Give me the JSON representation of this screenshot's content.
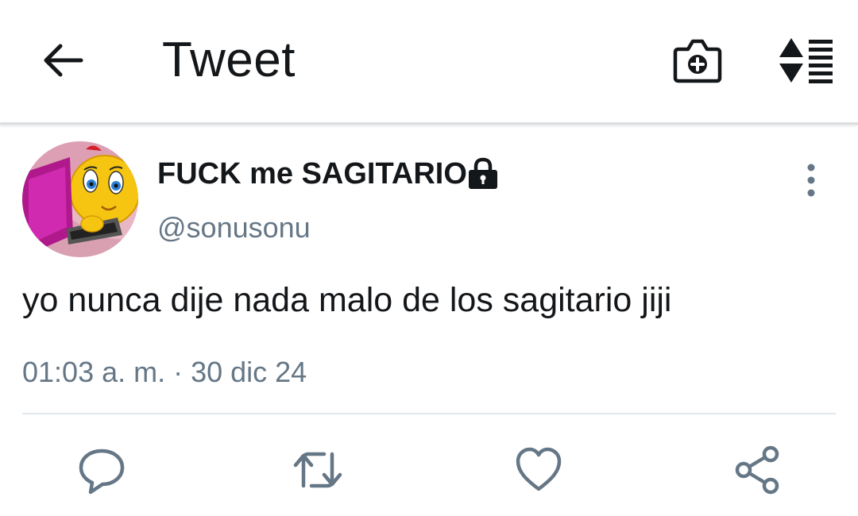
{
  "header": {
    "title": "Tweet",
    "back_icon": "arrow-left-icon",
    "camera_icon": "camera-add-icon",
    "sort_icon": "sort-list-icon"
  },
  "tweet": {
    "author_name": "FUCK me SAGITARIO",
    "handle": "@sonusonu",
    "protected_icon": "lock-icon",
    "text": "yo nunca dije nada malo de los sagitario jiji",
    "timestamp": "01:03 a. m. · 30 dic 24",
    "more_icon": "more-vertical-icon"
  },
  "actions": [
    {
      "name": "reply",
      "icon": "reply-icon"
    },
    {
      "name": "retweet",
      "icon": "retweet-icon"
    },
    {
      "name": "like",
      "icon": "heart-icon"
    },
    {
      "name": "share",
      "icon": "share-icon"
    }
  ],
  "colors": {
    "text_primary": "#14171a",
    "text_secondary": "#657786",
    "icon_action": "#657786",
    "divider": "#e1e8ed"
  }
}
